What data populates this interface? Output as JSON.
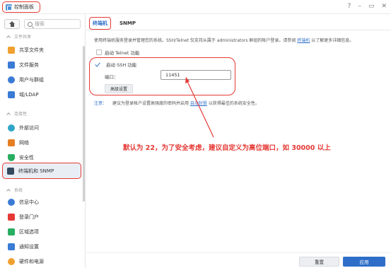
{
  "window": {
    "title": "控制面板",
    "controls": [
      "?",
      "–",
      "▭",
      "✕"
    ]
  },
  "sidebar": {
    "search_placeholder": "搜索",
    "sections": [
      {
        "header": "文件共享",
        "items": [
          {
            "label": "共享文件夹",
            "icon": "folder-icon",
            "color": "#f0a030"
          },
          {
            "label": "文件服务",
            "icon": "file-services-icon",
            "color": "#3a7bd5"
          },
          {
            "label": "用户与群组",
            "icon": "users-icon",
            "color": "#3a7bd5"
          },
          {
            "label": "域/LDAP",
            "icon": "ldap-icon",
            "color": "#3a7bd5"
          }
        ]
      },
      {
        "header": "连接性",
        "items": [
          {
            "label": "外部访问",
            "icon": "globe-icon",
            "color": "#2fa5c9"
          },
          {
            "label": "网络",
            "icon": "network-home-icon",
            "color": "#e67e22"
          },
          {
            "label": "安全性",
            "icon": "shield-icon",
            "color": "#27ae60"
          },
          {
            "label": "终端机和 SNMP",
            "icon": "terminal-icon",
            "color": "#34495e"
          }
        ]
      },
      {
        "header": "系统",
        "items": [
          {
            "label": "信息中心",
            "icon": "info-icon",
            "color": "#3a7bd5"
          },
          {
            "label": "登录门户",
            "icon": "login-portal-icon",
            "color": "#e53935"
          },
          {
            "label": "区域选项",
            "icon": "region-icon",
            "color": "#27ae60"
          },
          {
            "label": "通知设置",
            "icon": "notification-icon",
            "color": "#3a7bd5"
          },
          {
            "label": "硬件和电源",
            "icon": "power-icon",
            "color": "#f0a030"
          }
        ]
      }
    ]
  },
  "main": {
    "tabs": [
      "终端机",
      "SNMP"
    ],
    "description": "使用终端机服务登录并管理您的系统。SSH/Telnet 仅支持从属于 administrators 群组的帐户登录。请参阅",
    "description_link": "终端机",
    "description_tail": "以了解更多详细信息。",
    "telnet_label": "启动 Telnet 功能",
    "ssh_label": "启动 SSH 功能",
    "port_label": "端口：",
    "port_value": "11451",
    "advanced_button": "高级设置",
    "note_label": "注意：",
    "note_text": "建议为登录帐户设置高强度的密码并启用",
    "note_link": "自动封锁",
    "note_tail": "以获得最佳的系统安全性。",
    "annotation": "默认为 22，为了安全考虑，建议自定义为高位端口，如 30000 以上",
    "reset_button": "重置",
    "apply_button": "应用"
  },
  "colors": {
    "accent": "#2f6ec8",
    "highlight": "#e53935"
  }
}
